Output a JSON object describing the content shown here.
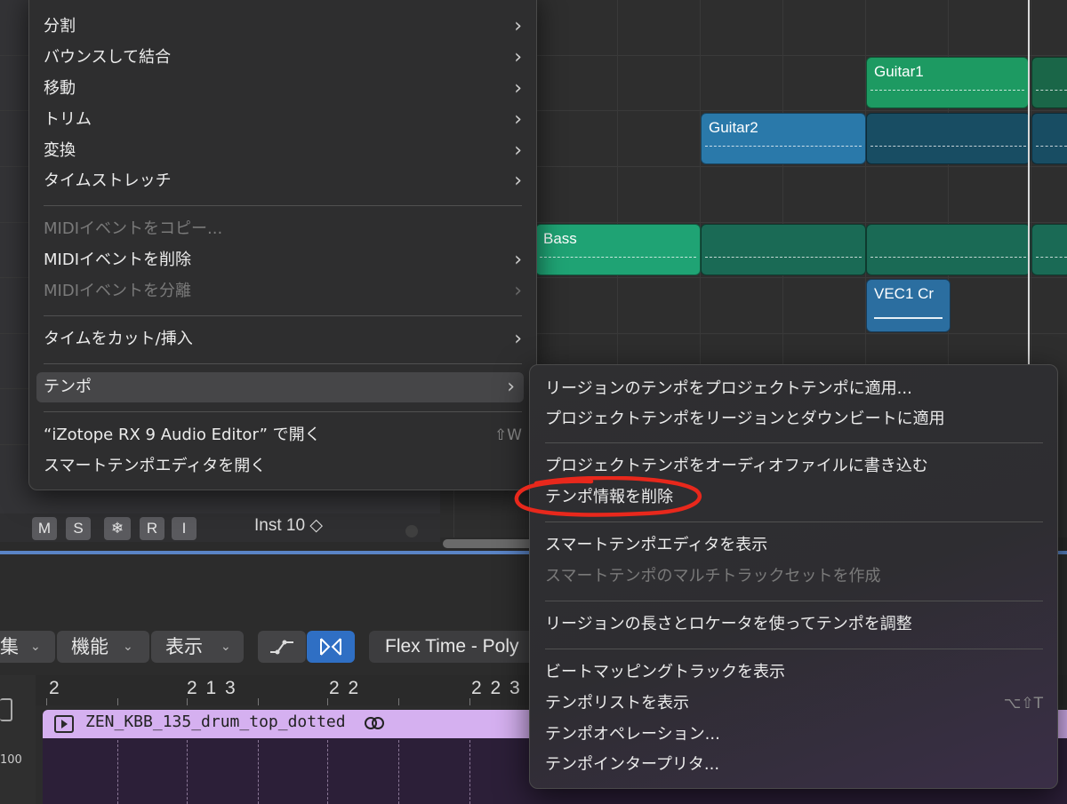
{
  "arrange": {
    "regions": [
      {
        "name": "Guitar1"
      },
      {
        "name": "Guitar2"
      },
      {
        "name": "Bass"
      },
      {
        "name": "VEC1 Cr"
      }
    ],
    "track_header": {
      "mute_label": "M",
      "solo_label": "S",
      "freeze_icon": "snowflake-icon",
      "record_label": "R",
      "input_label": "I",
      "instrument_name": "Inst 10 ◇"
    }
  },
  "main_menu": {
    "items": [
      {
        "label": "分割",
        "submenu": true,
        "disabled": false
      },
      {
        "label": "バウンスして結合",
        "submenu": true,
        "disabled": false
      },
      {
        "label": "移動",
        "submenu": true,
        "disabled": false
      },
      {
        "label": "トリム",
        "submenu": true,
        "disabled": false
      },
      {
        "label": "変換",
        "submenu": true,
        "disabled": false
      },
      {
        "label": "タイムストレッチ",
        "submenu": true,
        "disabled": false
      },
      {
        "label": "MIDIイベントをコピー...",
        "submenu": false,
        "disabled": true
      },
      {
        "label": "MIDIイベントを削除",
        "submenu": true,
        "disabled": false
      },
      {
        "label": "MIDIイベントを分離",
        "submenu": true,
        "disabled": true
      },
      {
        "label": "タイムをカット/挿入",
        "submenu": true,
        "disabled": false
      },
      {
        "label": "テンポ",
        "submenu": true,
        "disabled": false,
        "highlighted": true
      },
      {
        "label": "“iZotope RX 9 Audio Editor” で開く",
        "shortcut": "⇧W",
        "disabled": false
      },
      {
        "label": "スマートテンポエディタを開く",
        "disabled": false
      }
    ]
  },
  "tempo_submenu": {
    "items": [
      {
        "label": "リージョンのテンポをプロジェクトテンポに適用...",
        "disabled": false
      },
      {
        "label": "プロジェクトテンポをリージョンとダウンビートに適用",
        "disabled": false
      },
      {
        "label": "プロジェクトテンポをオーディオファイルに書き込む",
        "disabled": false
      },
      {
        "label": "テンポ情報を削除",
        "disabled": false,
        "annotated": true
      },
      {
        "label": "スマートテンポエディタを表示",
        "disabled": false
      },
      {
        "label": "スマートテンポのマルチトラックセットを作成",
        "disabled": true
      },
      {
        "label": "リージョンの長さとロケータを使ってテンポを調整",
        "disabled": false
      },
      {
        "label": "ビートマッピングトラックを表示",
        "disabled": false
      },
      {
        "label": "テンポリストを表示",
        "shortcut": "⌥⇧T",
        "disabled": false
      },
      {
        "label": "テンポオペレーション...",
        "disabled": false
      },
      {
        "label": "テンポインタープリタ...",
        "disabled": false
      }
    ],
    "annotation_color": "#e8281c"
  },
  "editor": {
    "toolbar": {
      "edit_label": "集",
      "functions_label": "機能",
      "view_label": "表示",
      "flex_mode": "Flex Time - Poly"
    },
    "ruler": [
      "2",
      "2 1 3",
      "2 2",
      "2 2 3"
    ],
    "y_axis_label": "100",
    "region_name": "ZEN_KBB_135_drum_top_dotted"
  },
  "colors": {
    "accent_blue": "#5a84c6",
    "audio_region": "#d5b0f0",
    "green_region": "#1fa374",
    "blue_region": "#2a79aa"
  }
}
